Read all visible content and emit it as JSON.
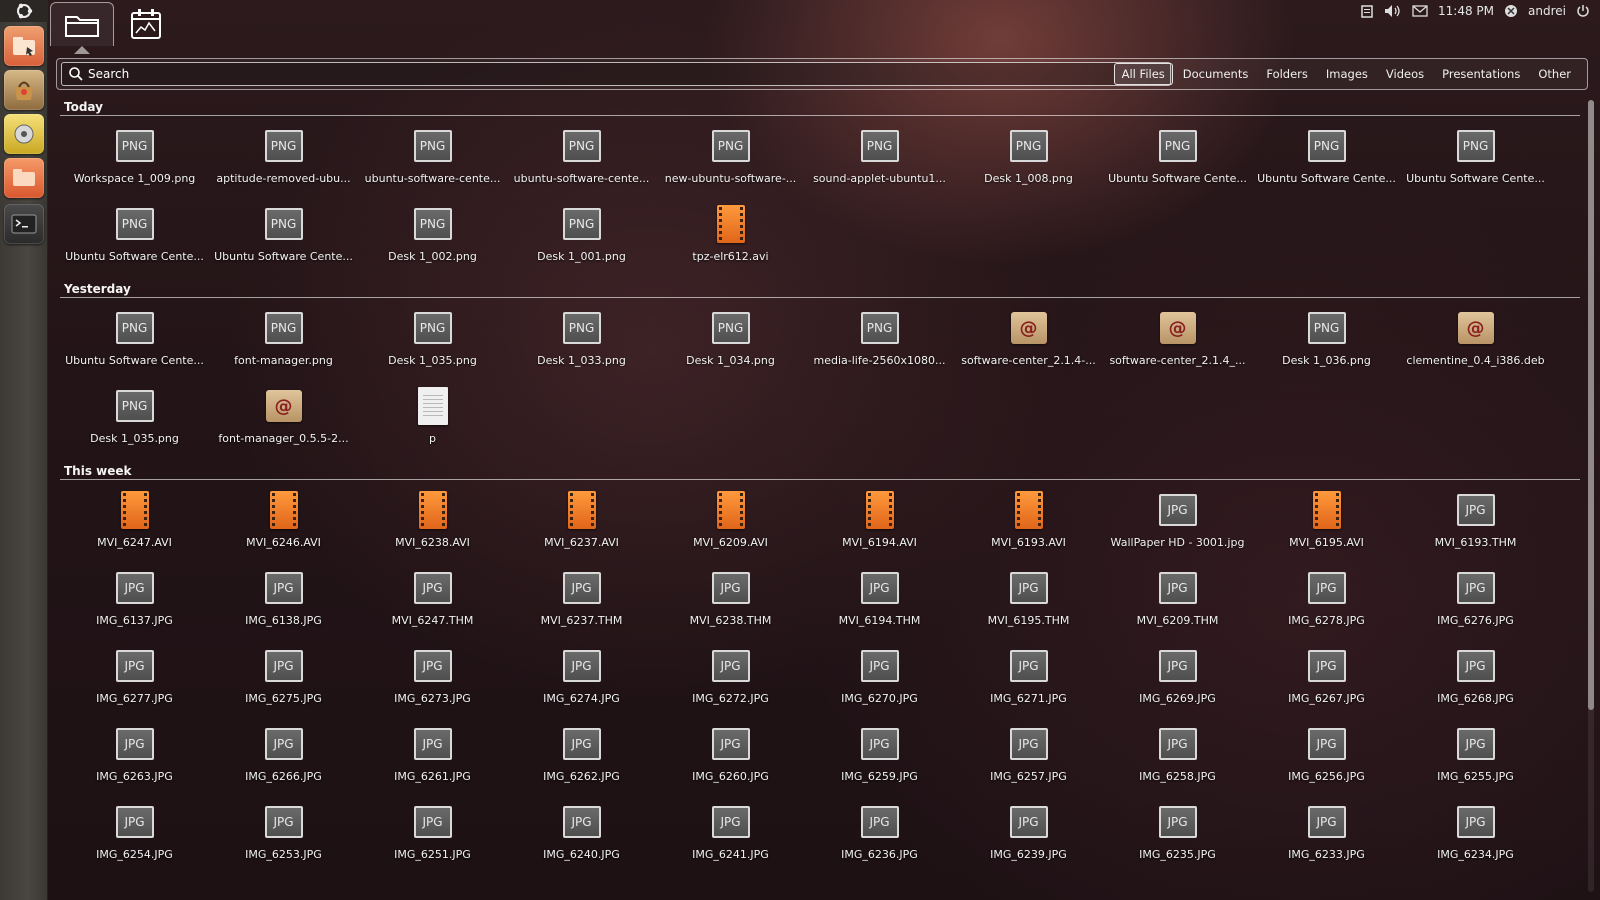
{
  "top_panel": {
    "clock": "11:48 PM",
    "user": "andrei",
    "icons": [
      "clipboard-indicator-icon",
      "volume-icon",
      "mail-icon",
      "user-icon",
      "power-icon"
    ]
  },
  "launcher": {
    "items": [
      "files-folders-app-icon",
      "software-center-icon",
      "disk-utility-icon",
      "file-manager-icon",
      "terminal-icon"
    ]
  },
  "lenses": {
    "files": "folder-lens-icon",
    "apps": "applications-lens-icon"
  },
  "search": {
    "placeholder": "Search",
    "value": ""
  },
  "filters": [
    {
      "label": "All Files",
      "active": true
    },
    {
      "label": "Documents",
      "active": false
    },
    {
      "label": "Folders",
      "active": false
    },
    {
      "label": "Images",
      "active": false
    },
    {
      "label": "Videos",
      "active": false
    },
    {
      "label": "Presentations",
      "active": false
    },
    {
      "label": "Other",
      "active": false
    }
  ],
  "groups": [
    {
      "title": "Today",
      "items": [
        {
          "name": "Workspace 1_009.png",
          "type": "png"
        },
        {
          "name": "aptitude-removed-ubu...",
          "type": "png"
        },
        {
          "name": "ubuntu-software-cente...",
          "type": "png"
        },
        {
          "name": "ubuntu-software-cente...",
          "type": "png"
        },
        {
          "name": "new-ubuntu-software-...",
          "type": "png"
        },
        {
          "name": "sound-applet-ubuntu1...",
          "type": "png"
        },
        {
          "name": "Desk 1_008.png",
          "type": "png"
        },
        {
          "name": "Ubuntu Software Cente...",
          "type": "png"
        },
        {
          "name": "Ubuntu Software Cente...",
          "type": "png"
        },
        {
          "name": "Ubuntu Software Cente...",
          "type": "png"
        },
        {
          "name": "Ubuntu Software Cente...",
          "type": "png"
        },
        {
          "name": "Ubuntu Software Cente...",
          "type": "png"
        },
        {
          "name": "Desk 1_002.png",
          "type": "png"
        },
        {
          "name": "Desk 1_001.png",
          "type": "png"
        },
        {
          "name": "tpz-elr612.avi",
          "type": "video"
        }
      ]
    },
    {
      "title": "Yesterday",
      "items": [
        {
          "name": "Ubuntu Software Cente...",
          "type": "png"
        },
        {
          "name": "font-manager.png",
          "type": "png"
        },
        {
          "name": "Desk 1_035.png",
          "type": "png"
        },
        {
          "name": "Desk 1_033.png",
          "type": "png"
        },
        {
          "name": "Desk 1_034.png",
          "type": "png"
        },
        {
          "name": "media-life-2560x1080...",
          "type": "png"
        },
        {
          "name": "software-center_2.1.4-...",
          "type": "deb"
        },
        {
          "name": "software-center_2.1.4_...",
          "type": "deb"
        },
        {
          "name": "Desk 1_036.png",
          "type": "png"
        },
        {
          "name": "clementine_0.4_i386.deb",
          "type": "deb"
        },
        {
          "name": "Desk 1_035.png",
          "type": "png"
        },
        {
          "name": "font-manager_0.5.5-2...",
          "type": "deb"
        },
        {
          "name": "p",
          "type": "text"
        }
      ]
    },
    {
      "title": "This week",
      "items": [
        {
          "name": "MVI_6247.AVI",
          "type": "video"
        },
        {
          "name": "MVI_6246.AVI",
          "type": "video"
        },
        {
          "name": "MVI_6238.AVI",
          "type": "video"
        },
        {
          "name": "MVI_6237.AVI",
          "type": "video"
        },
        {
          "name": "MVI_6209.AVI",
          "type": "video"
        },
        {
          "name": "MVI_6194.AVI",
          "type": "video"
        },
        {
          "name": "MVI_6193.AVI",
          "type": "video"
        },
        {
          "name": "WallPaper HD - 3001.jpg",
          "type": "jpg"
        },
        {
          "name": "MVI_6195.AVI",
          "type": "video"
        },
        {
          "name": "MVI_6193.THM",
          "type": "jpg"
        },
        {
          "name": "IMG_6137.JPG",
          "type": "jpg"
        },
        {
          "name": "IMG_6138.JPG",
          "type": "jpg"
        },
        {
          "name": "MVI_6247.THM",
          "type": "jpg"
        },
        {
          "name": "MVI_6237.THM",
          "type": "jpg"
        },
        {
          "name": "MVI_6238.THM",
          "type": "jpg"
        },
        {
          "name": "MVI_6194.THM",
          "type": "jpg"
        },
        {
          "name": "MVI_6195.THM",
          "type": "jpg"
        },
        {
          "name": "MVI_6209.THM",
          "type": "jpg"
        },
        {
          "name": "IMG_6278.JPG",
          "type": "jpg"
        },
        {
          "name": "IMG_6276.JPG",
          "type": "jpg"
        },
        {
          "name": "IMG_6277.JPG",
          "type": "jpg"
        },
        {
          "name": "IMG_6275.JPG",
          "type": "jpg"
        },
        {
          "name": "IMG_6273.JPG",
          "type": "jpg"
        },
        {
          "name": "IMG_6274.JPG",
          "type": "jpg"
        },
        {
          "name": "IMG_6272.JPG",
          "type": "jpg"
        },
        {
          "name": "IMG_6270.JPG",
          "type": "jpg"
        },
        {
          "name": "IMG_6271.JPG",
          "type": "jpg"
        },
        {
          "name": "IMG_6269.JPG",
          "type": "jpg"
        },
        {
          "name": "IMG_6267.JPG",
          "type": "jpg"
        },
        {
          "name": "IMG_6268.JPG",
          "type": "jpg"
        },
        {
          "name": "IMG_6263.JPG",
          "type": "jpg"
        },
        {
          "name": "IMG_6266.JPG",
          "type": "jpg"
        },
        {
          "name": "IMG_6261.JPG",
          "type": "jpg"
        },
        {
          "name": "IMG_6262.JPG",
          "type": "jpg"
        },
        {
          "name": "IMG_6260.JPG",
          "type": "jpg"
        },
        {
          "name": "IMG_6259.JPG",
          "type": "jpg"
        },
        {
          "name": "IMG_6257.JPG",
          "type": "jpg"
        },
        {
          "name": "IMG_6258.JPG",
          "type": "jpg"
        },
        {
          "name": "IMG_6256.JPG",
          "type": "jpg"
        },
        {
          "name": "IMG_6255.JPG",
          "type": "jpg"
        },
        {
          "name": "IMG_6254.JPG",
          "type": "jpg"
        },
        {
          "name": "IMG_6253.JPG",
          "type": "jpg"
        },
        {
          "name": "IMG_6251.JPG",
          "type": "jpg"
        },
        {
          "name": "IMG_6240.JPG",
          "type": "jpg"
        },
        {
          "name": "IMG_6241.JPG",
          "type": "jpg"
        },
        {
          "name": "IMG_6236.JPG",
          "type": "jpg"
        },
        {
          "name": "IMG_6239.JPG",
          "type": "jpg"
        },
        {
          "name": "IMG_6235.JPG",
          "type": "jpg"
        },
        {
          "name": "IMG_6233.JPG",
          "type": "jpg"
        },
        {
          "name": "IMG_6234.JPG",
          "type": "jpg"
        }
      ]
    }
  ],
  "thumb_labels": {
    "png": "PNG",
    "jpg": "JPG"
  },
  "colors": {
    "accent_border": "#ffffff",
    "video_orange": "#f07a28",
    "panel_bg": "#2c1a1d"
  }
}
